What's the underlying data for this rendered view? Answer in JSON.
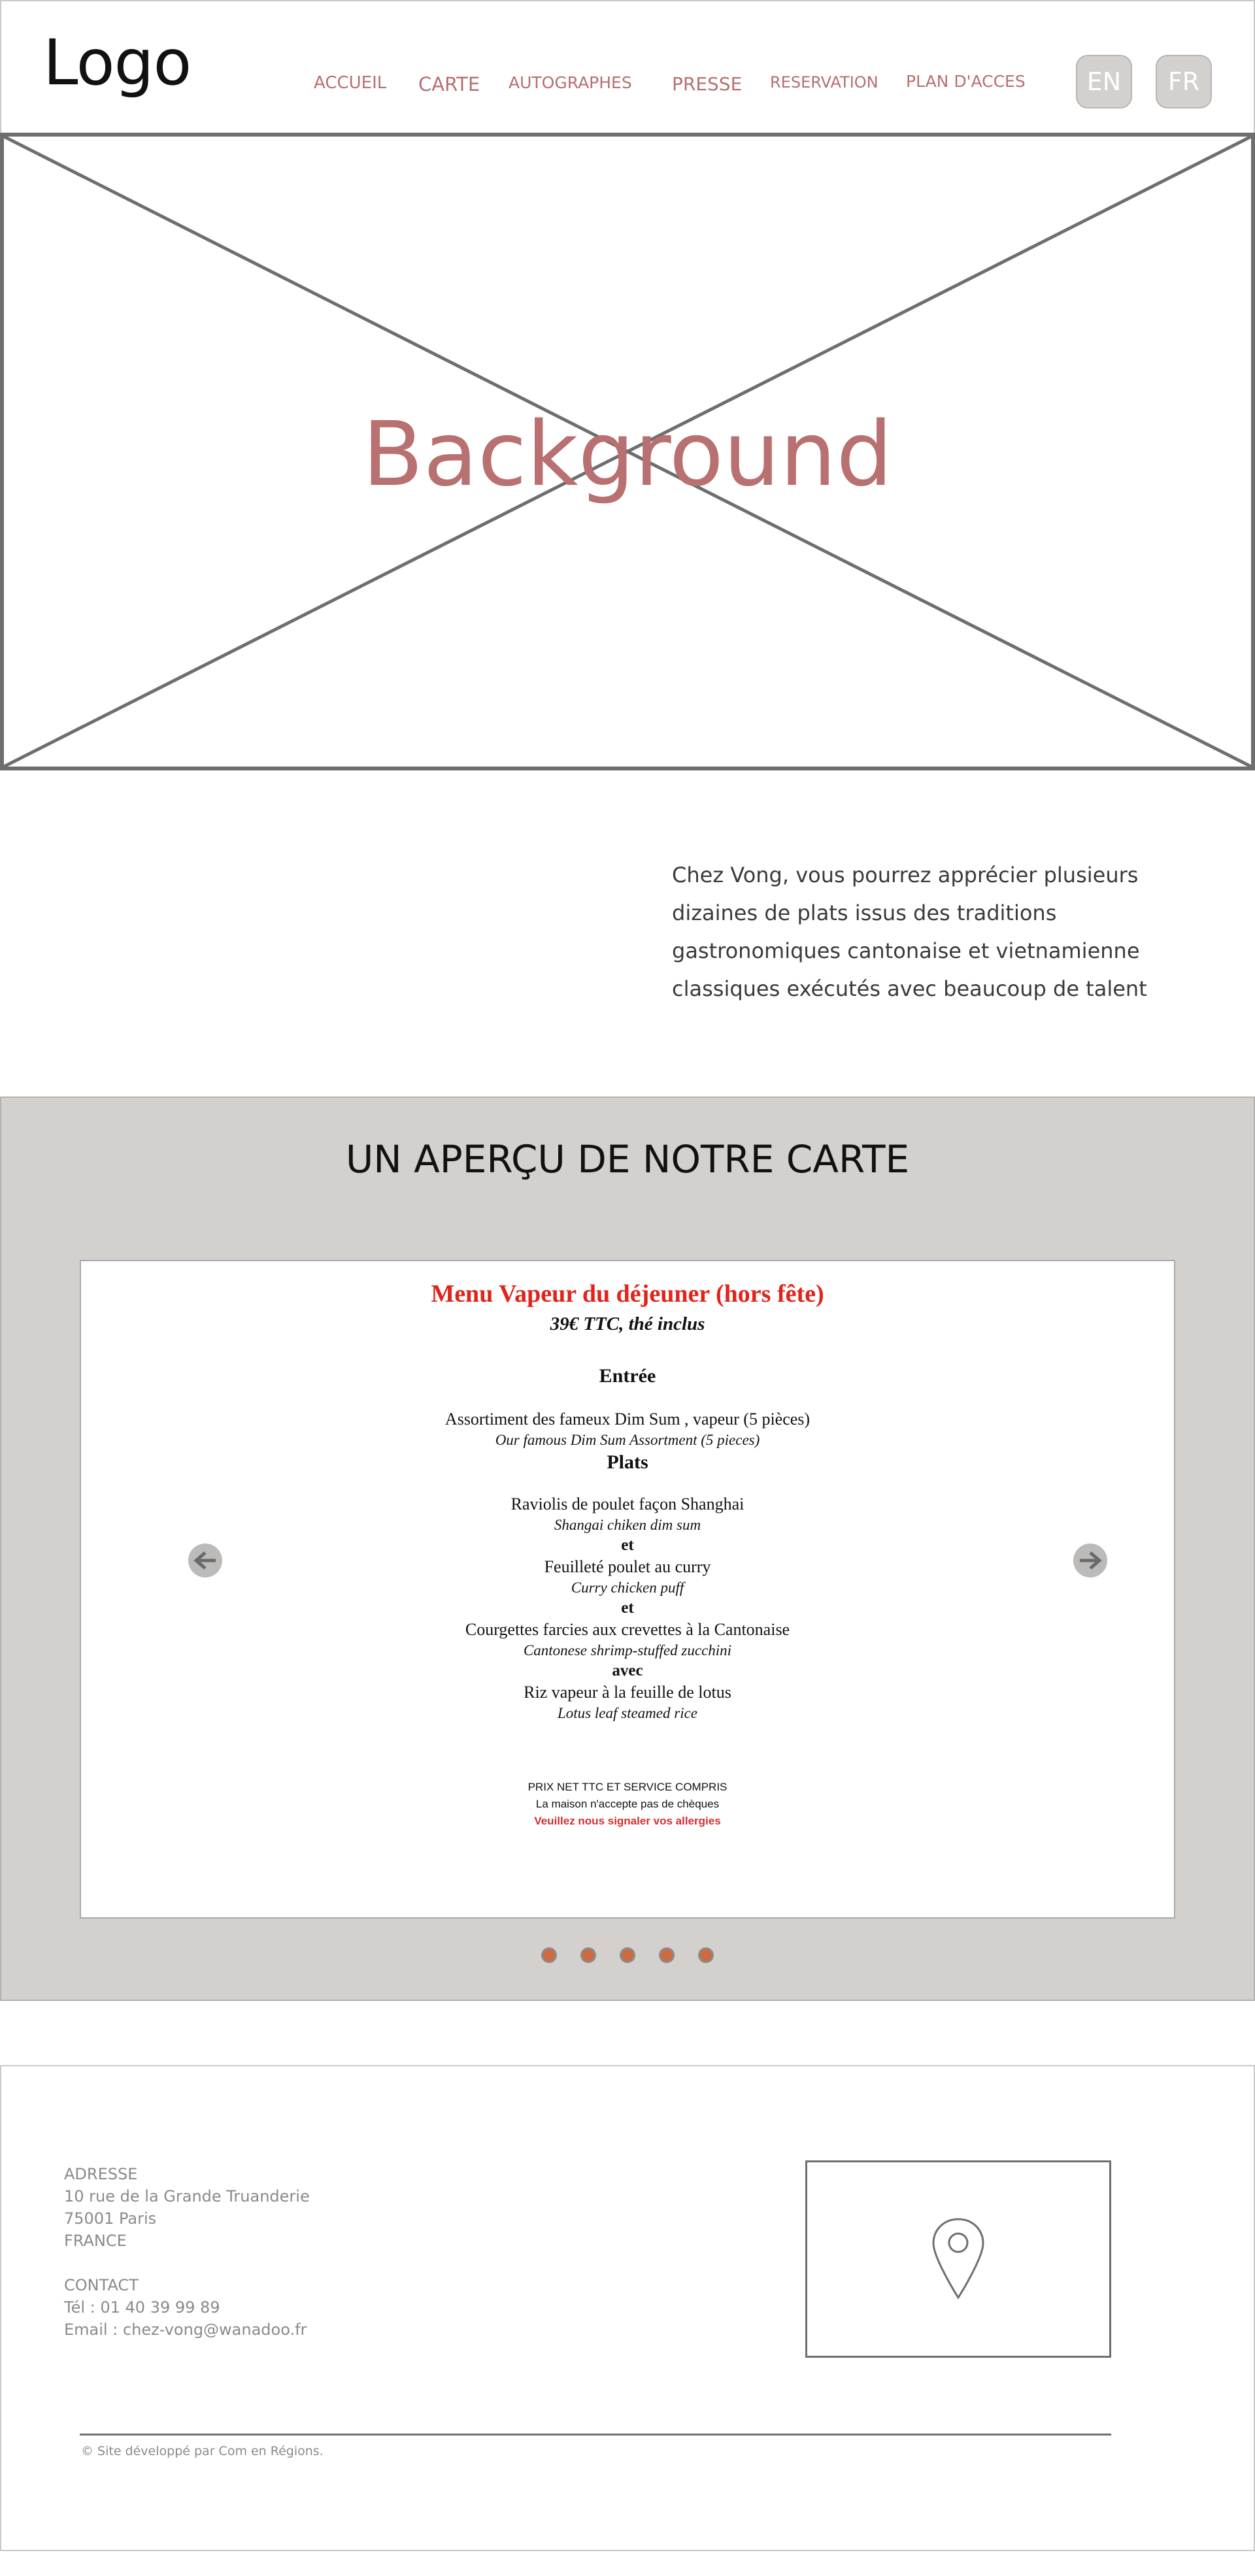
{
  "header": {
    "logo": "Logo",
    "nav": [
      "ACCUEIL",
      "CARTE",
      "AUTOGRAPHES",
      "PRESSE",
      "RESERVATION",
      "PLAN D'ACCES"
    ],
    "lang": [
      "EN",
      "FR"
    ]
  },
  "hero": {
    "label": "Background"
  },
  "intro": {
    "text": "Chez Vong, vous pourrez apprécier plusieurs dizaines de plats issus des traditions gastronomiques cantonaise et vietnamienne classiques exécutés avec beaucoup de talent"
  },
  "menu_preview": {
    "title": "UN APERÇU DE NOTRE CARTE",
    "card": {
      "heading": "Menu Vapeur du déjeuner (hors fête)",
      "price": "39€  TTC, thé inclus",
      "entree_label": "Entrée",
      "entree_item": "Assortiment des fameux Dim Sum , vapeur (5 pièces)",
      "entree_tr": "Our famous Dim Sum Assortment (5 pieces)",
      "plats_label": "Plats",
      "plat1": "Raviolis de poulet façon Shanghai",
      "plat1_tr": "Shangai chiken dim sum",
      "et1": "et",
      "plat2": "Feuilleté poulet au curry",
      "plat2_tr": "Curry chicken puff",
      "et2": "et",
      "plat3": "Courgettes farcies aux crevettes à la Cantonaise",
      "plat3_tr": "Cantonese shrimp-stuffed zucchini",
      "avec": "avec",
      "plat4": "Riz vapeur à la feuille de lotus",
      "plat4_tr": "Lotus leaf steamed rice",
      "fine1": "PRIX  NET TTC ET SERVICE COMPRIS",
      "fine2": "La maison n'accepte pas de chèques",
      "fine3": "Veuillez nous signaler vos allergies"
    },
    "carousel_dot_count": 5
  },
  "footer": {
    "address_label": "ADRESSE",
    "address_line1": "10 rue de la Grande Truanderie",
    "address_line2": "75001 Paris",
    "address_line3": "FRANCE",
    "contact_label": "CONTACT",
    "phone": "Tél : 01 40 39 99 89",
    "email": "Email : chez-vong@wanadoo.fr",
    "credit": "© Site développé par Com en Régions."
  },
  "colors": {
    "nav": "#b76f6f",
    "hero_text": "#b87070",
    "menu_bg": "#d3d0ce",
    "menu_heading": "#e2231a",
    "dot": "#cf6a3e"
  },
  "icons": {
    "prev": "arrow-left-icon",
    "next": "arrow-right-icon",
    "map": "map-pin-icon"
  }
}
